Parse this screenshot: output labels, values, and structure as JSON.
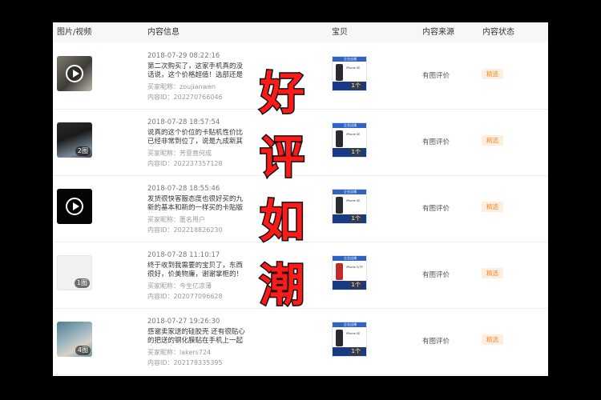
{
  "table": {
    "headers": {
      "media": "图片/视频",
      "info": "内容信息",
      "item": "宝贝",
      "source": "内容来源",
      "status": "内容状态"
    },
    "rows": [
      {
        "media_type": "video",
        "media_icon": "play-icon",
        "media_count": "",
        "date": "2018-07-29 08:22:16",
        "desc": "第二次购买了，这家手机真的没话说，这个价格超值！选部还是绝版…",
        "nick": "买家昵称：zoujianwen",
        "content_id": "内容ID：202270766046",
        "item_badge": "1个",
        "source": "有图评价",
        "status": "精选"
      },
      {
        "media_type": "image",
        "media_icon": "phone-photo",
        "media_count": "2图",
        "date": "2018-07-28 18:57:54",
        "desc": "说真的这个价位的卡贴机性价比已经非常到位了，说是九成新其实和全…",
        "nick": "买家昵称：芳意竟何成",
        "content_id": "内容ID：202237357128",
        "item_badge": "1个",
        "source": "有图评价",
        "status": "精选"
      },
      {
        "media_type": "video",
        "media_icon": "play-icon",
        "media_count": "",
        "date": "2018-07-28 18:55:46",
        "desc": "发货很快客服态度也很好买的九新的基本和新的一样买的卡贴版的插卡…",
        "nick": "买家昵称：匿名用户",
        "content_id": "内容ID：202218826230",
        "item_badge": "1个",
        "source": "有图评价",
        "status": "精选"
      },
      {
        "media_type": "image",
        "media_icon": "paper-photo",
        "media_count": "1图",
        "date": "2018-07-28 11:10:17",
        "desc": "终于收到我需要的宝贝了，东西很好，价美物廉，谢谢掌柜的！说实…",
        "nick": "买家昵称：今生亿凉薄",
        "content_id": "内容ID：202077096628",
        "item_badge": "1个",
        "source": "有图评价",
        "status": "精选"
      },
      {
        "media_type": "image",
        "media_icon": "hand-photo",
        "media_count": "4图",
        "date": "2018-07-27 19:26:30",
        "desc": "感谢卖家送的硅胶壳 还有很贴心的把送的钢化膜贴在手机上一起发了过来",
        "nick": "买家昵称：lakers724",
        "content_id": "内容ID：202178335395",
        "item_badge": "1个",
        "source": "有图评价",
        "status": "精选"
      }
    ]
  },
  "overlay": {
    "chars": [
      "好",
      "评",
      "如",
      "潮"
    ],
    "color": "#ff1a1a"
  },
  "colors": {
    "status_text": "#f08a24",
    "status_bg": "#fdeee0",
    "header_bg": "#f6f7f9"
  }
}
